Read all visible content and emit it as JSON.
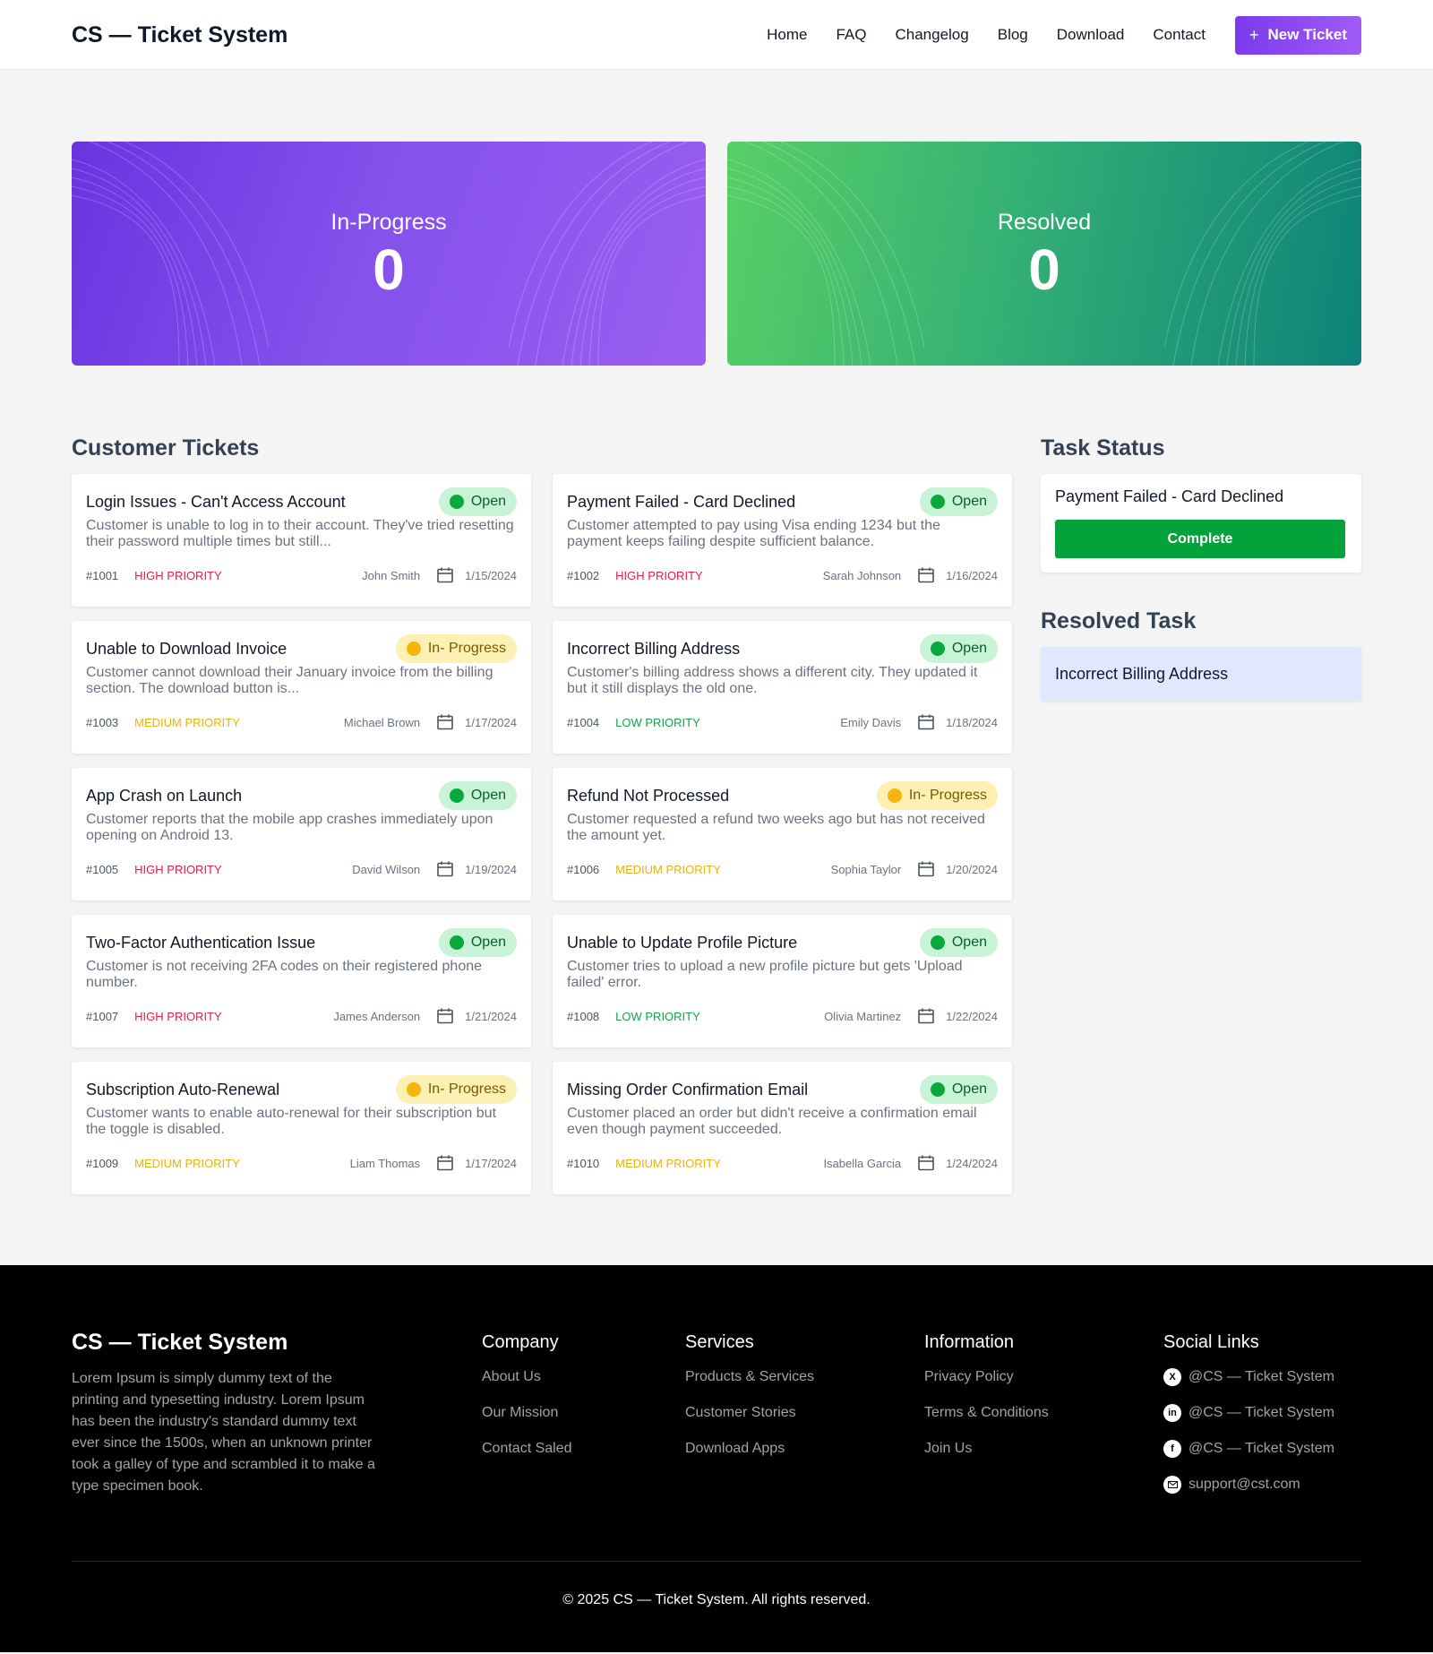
{
  "header": {
    "logo": "CS — Ticket System",
    "nav": [
      "Home",
      "FAQ",
      "Changelog",
      "Blog",
      "Download",
      "Contact"
    ],
    "new_ticket_label": "New Ticket"
  },
  "stats": {
    "in_progress": {
      "label": "In-Progress",
      "value": "0"
    },
    "resolved": {
      "label": "Resolved",
      "value": "0"
    }
  },
  "tickets_section": {
    "title": "Customer Tickets"
  },
  "tickets": [
    {
      "title": "Login Issues - Can't Access Account",
      "status": "Open",
      "desc": "Customer is unable to log in to their account. They've tried resetting their password multiple times but still...",
      "id": "#1001",
      "priority": "HIGH PRIORITY",
      "customer": "John Smith",
      "date": "1/15/2024"
    },
    {
      "title": "Payment Failed - Card Declined",
      "status": "Open",
      "desc": "Customer attempted to pay using Visa ending 1234 but the payment keeps failing despite sufficient balance.",
      "id": "#1002",
      "priority": "HIGH PRIORITY",
      "customer": "Sarah Johnson",
      "date": "1/16/2024"
    },
    {
      "title": "Unable to Download Invoice",
      "status": "In- Progress",
      "desc": "Customer cannot download their January invoice from the billing section. The download button is...",
      "id": "#1003",
      "priority": "MEDIUM PRIORITY",
      "customer": "Michael Brown",
      "date": "1/17/2024"
    },
    {
      "title": "Incorrect Billing Address",
      "status": "Open",
      "desc": "Customer's billing address shows a different city. They updated it but it still displays the old one.",
      "id": "#1004",
      "priority": "LOW PRIORITY",
      "customer": "Emily Davis",
      "date": "1/18/2024"
    },
    {
      "title": "App Crash on Launch",
      "status": "Open",
      "desc": "Customer reports that the mobile app crashes immediately upon opening on Android 13.",
      "id": "#1005",
      "priority": "HIGH PRIORITY",
      "customer": "David Wilson",
      "date": "1/19/2024"
    },
    {
      "title": "Refund Not Processed",
      "status": "In- Progress",
      "desc": "Customer requested a refund two weeks ago but has not received the amount yet.",
      "id": "#1006",
      "priority": "MEDIUM PRIORITY",
      "customer": "Sophia Taylor",
      "date": "1/20/2024"
    },
    {
      "title": "Two-Factor Authentication Issue",
      "status": "Open",
      "desc": "Customer is not receiving 2FA codes on their registered phone number.",
      "id": "#1007",
      "priority": "HIGH PRIORITY",
      "customer": "James Anderson",
      "date": "1/21/2024"
    },
    {
      "title": "Unable to Update Profile Picture",
      "status": "Open",
      "desc": "Customer tries to upload a new profile picture but gets 'Upload failed' error.",
      "id": "#1008",
      "priority": "LOW PRIORITY",
      "customer": "Olivia Martinez",
      "date": "1/22/2024"
    },
    {
      "title": "Subscription Auto-Renewal",
      "status": "In- Progress",
      "desc": "Customer wants to enable auto-renewal for their subscription but the toggle is disabled.",
      "id": "#1009",
      "priority": "MEDIUM PRIORITY",
      "customer": "Liam Thomas",
      "date": "1/17/2024"
    },
    {
      "title": "Missing Order Confirmation Email",
      "status": "Open",
      "desc": "Customer placed an order but didn't receive a confirmation email even though payment succeeded.",
      "id": "#1010",
      "priority": "MEDIUM PRIORITY",
      "customer": "Isabella Garcia",
      "date": "1/24/2024"
    }
  ],
  "task_status": {
    "title": "Task Status",
    "task": "Payment Failed - Card Declined",
    "complete_label": "Complete"
  },
  "resolved_task": {
    "title": "Resolved Task",
    "items": [
      "Incorrect Billing Address"
    ]
  },
  "footer": {
    "logo": "CS — Ticket System",
    "about": "Lorem Ipsum is simply dummy text of the printing and typesetting industry. Lorem Ipsum has been the industry's standard dummy text ever since the 1500s, when an unknown printer took a galley of type and scrambled it to make a type specimen book.",
    "company": {
      "title": "Company",
      "links": [
        "About Us",
        "Our Mission",
        "Contact Saled"
      ]
    },
    "services": {
      "title": "Services",
      "links": [
        "Products & Services",
        "Customer Stories",
        "Download Apps"
      ]
    },
    "information": {
      "title": "Information",
      "links": [
        "Privacy Policy",
        "Terms & Conditions",
        "Join Us"
      ]
    },
    "social": {
      "title": "Social Links",
      "links": [
        {
          "icon": "x-icon",
          "label": "@CS — Ticket System"
        },
        {
          "icon": "linkedin-icon",
          "label": "@CS — Ticket System"
        },
        {
          "icon": "facebook-icon",
          "label": "@CS — Ticket System"
        },
        {
          "icon": "email-icon",
          "label": "support@cst.com"
        }
      ]
    },
    "copyright": "© 2025 CS — Ticket System. All rights reserved."
  },
  "colors": {
    "primary": "#7c3aed",
    "open": "#09a83c",
    "in_progress": "#f5b60b",
    "high": "#e11d48",
    "medium": "#e9b20a",
    "low": "#16a34a",
    "complete": "#04a23b"
  }
}
